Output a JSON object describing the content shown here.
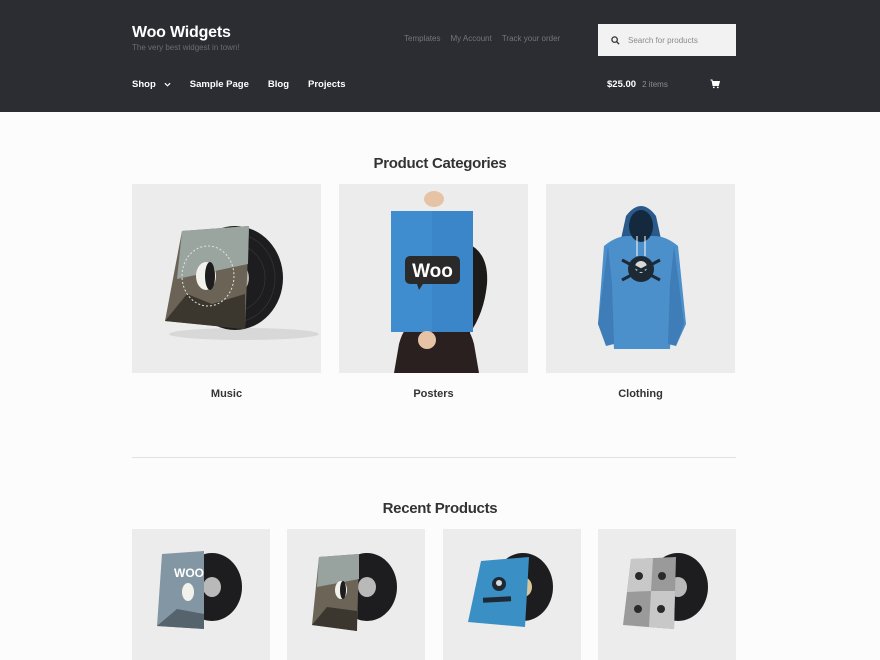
{
  "header": {
    "site_title": "Woo Widgets",
    "site_description": "The very best widgest in town!",
    "secondary_nav": [
      "Templates",
      "My Account",
      "Track your order"
    ],
    "search_placeholder": "Search for products",
    "bg_color": "#2c2d33"
  },
  "main_nav": {
    "items": [
      {
        "label": "Shop",
        "has_dropdown": true
      },
      {
        "label": "Sample Page"
      },
      {
        "label": "Blog"
      },
      {
        "label": "Projects"
      }
    ]
  },
  "cart": {
    "amount": "$25.00",
    "count": "2 items",
    "icon": "cart-icon"
  },
  "categories": {
    "title": "Product Categories",
    "items": [
      {
        "label": "Music",
        "image": "vinyl-record-image"
      },
      {
        "label": "Posters",
        "image": "woo-poster-image"
      },
      {
        "label": "Clothing",
        "image": "blue-hoodie-image"
      }
    ]
  },
  "recent": {
    "title": "Recent Products",
    "items": [
      {
        "image": "woo-album-image"
      },
      {
        "image": "woothemes-album-image"
      },
      {
        "image": "blue-woothemes-album-image"
      },
      {
        "image": "ninja-album-image"
      }
    ]
  }
}
